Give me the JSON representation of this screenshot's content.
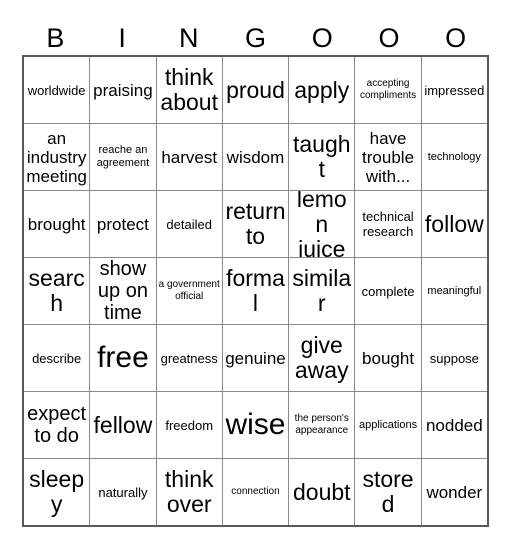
{
  "card": {
    "title_letters": [
      "B",
      "I",
      "N",
      "G",
      "O",
      "O",
      "O"
    ],
    "columns": 7,
    "rows": 7,
    "colors": {
      "background": "#ffffff",
      "text": "#000000",
      "outer_border": "#58595b",
      "inner_border": "#8a8a8d"
    },
    "cells": [
      [
        {
          "text": "worldwide",
          "size": "sm"
        },
        {
          "text": "praising",
          "size": "md"
        },
        {
          "text": "think about",
          "size": "xl"
        },
        {
          "text": "proud",
          "size": "xl"
        },
        {
          "text": "apply",
          "size": "xl"
        },
        {
          "text": "accepting compliments",
          "size": "xxs"
        },
        {
          "text": "impressed",
          "size": "sm"
        }
      ],
      [
        {
          "text": "an industry meeting",
          "size": "md"
        },
        {
          "text": "reache an agreement",
          "size": "xs"
        },
        {
          "text": "harvest",
          "size": "md"
        },
        {
          "text": "wisdom",
          "size": "md"
        },
        {
          "text": "taught",
          "size": "xl"
        },
        {
          "text": "have trouble with...",
          "size": "md"
        },
        {
          "text": "technology",
          "size": "xs"
        }
      ],
      [
        {
          "text": "brought",
          "size": "md"
        },
        {
          "text": "protect",
          "size": "md"
        },
        {
          "text": "detailed",
          "size": "sm"
        },
        {
          "text": "return to",
          "size": "xl"
        },
        {
          "text": "lemon juice",
          "size": "xl"
        },
        {
          "text": "technical research",
          "size": "sm"
        },
        {
          "text": "follow",
          "size": "xl"
        }
      ],
      [
        {
          "text": "search",
          "size": "xl"
        },
        {
          "text": "show up on time",
          "size": "lg"
        },
        {
          "text": "a government official",
          "size": "xxs"
        },
        {
          "text": "formal",
          "size": "xl"
        },
        {
          "text": "similar",
          "size": "xl"
        },
        {
          "text": "complete",
          "size": "sm"
        },
        {
          "text": "meaningful",
          "size": "xs"
        }
      ],
      [
        {
          "text": "describe",
          "size": "sm"
        },
        {
          "text": "free",
          "size": "huge"
        },
        {
          "text": "greatness",
          "size": "sm"
        },
        {
          "text": "genuine",
          "size": "md"
        },
        {
          "text": "give away",
          "size": "xl"
        },
        {
          "text": "bought",
          "size": "md"
        },
        {
          "text": "suppose",
          "size": "sm"
        }
      ],
      [
        {
          "text": "expect to do",
          "size": "lg"
        },
        {
          "text": "fellow",
          "size": "xl"
        },
        {
          "text": "freedom",
          "size": "sm"
        },
        {
          "text": "wise",
          "size": "huge"
        },
        {
          "text": "the person's appearance",
          "size": "xxs"
        },
        {
          "text": "applications",
          "size": "xs"
        },
        {
          "text": "nodded",
          "size": "md"
        }
      ],
      [
        {
          "text": "sleepy",
          "size": "xl"
        },
        {
          "text": "naturally",
          "size": "sm"
        },
        {
          "text": "think over",
          "size": "xl"
        },
        {
          "text": "connection",
          "size": "xxs"
        },
        {
          "text": "doubt",
          "size": "xl"
        },
        {
          "text": "stored",
          "size": "xl"
        },
        {
          "text": "wonder",
          "size": "md"
        }
      ]
    ]
  }
}
